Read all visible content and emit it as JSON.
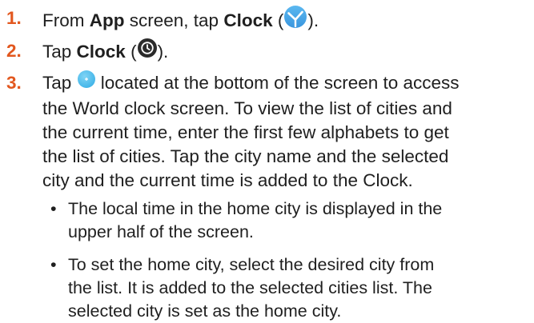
{
  "steps": [
    {
      "number": "1.",
      "t1": "From ",
      "b1": "App",
      "t2": " screen, tap ",
      "b2": "Clock",
      "t3": " (",
      "icon": "clock-app-icon",
      "t4": ")."
    },
    {
      "number": "2.",
      "t1": "Tap ",
      "b1": "Clock",
      "t2": " (",
      "icon": "clock-tab-icon",
      "t3": ")."
    },
    {
      "number": "3.",
      "line1_pre": "Tap ",
      "icon": "add-city-button-icon",
      "line1_post": " located at the bottom of the screen to access",
      "line2": "the World clock screen. To view the list of cities and",
      "line3": "the current time, enter the first few alphabets to get",
      "line4": "the list of cities. Tap the city name and the selected",
      "line5": "city and the current time is added to the Clock."
    }
  ],
  "bullets": [
    {
      "symbol": "•",
      "line1": "The local time in the home city is displayed in the",
      "line2": "upper half of the screen."
    },
    {
      "symbol": "•",
      "line1": "To set the home city, select the desired city from",
      "line2": "the list. It is added to the selected cities list. The",
      "line3": "selected city is set as the home city."
    }
  ],
  "colors": {
    "step_number": "#e2571e",
    "clock_app_icon": "#47a8e8",
    "clock_tab_icon": "#2b2b2b",
    "add_button": "#56c1ee"
  }
}
